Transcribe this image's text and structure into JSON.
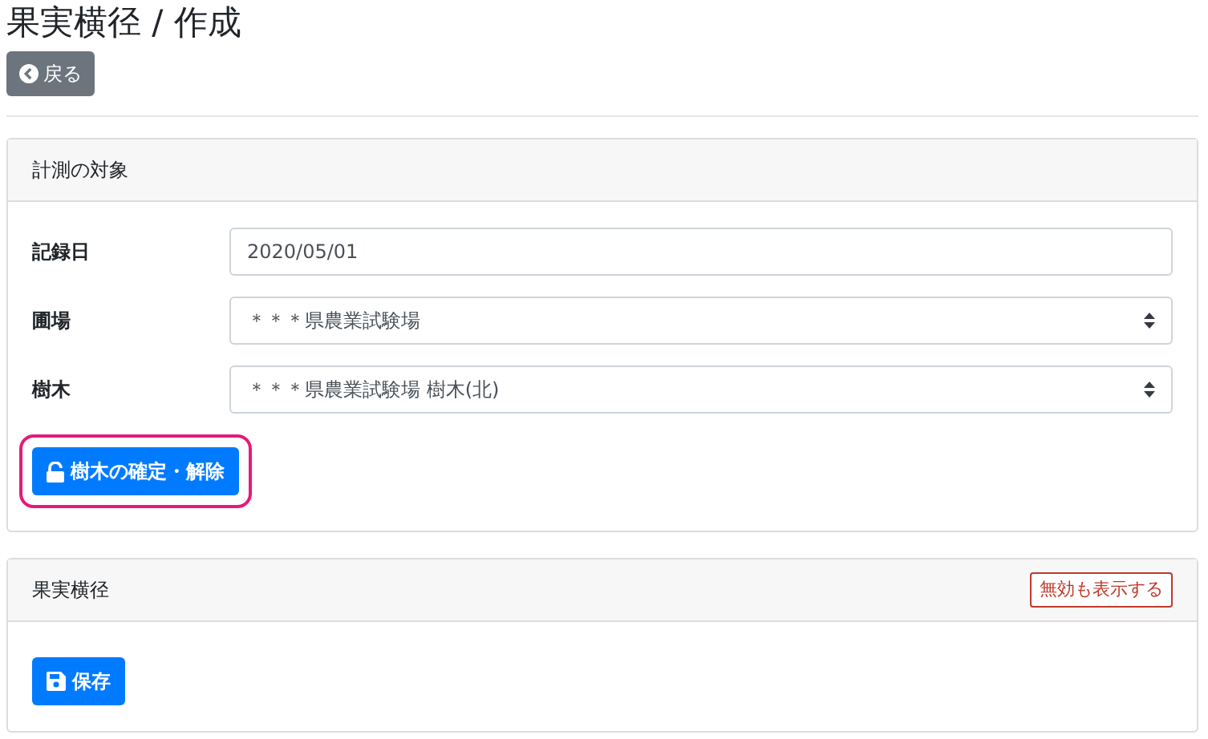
{
  "title": "果実横径 / 作成",
  "back_button": "戻る",
  "target_card": {
    "header": "計測の対象",
    "fields": [
      {
        "kind": "input",
        "label": "記録日",
        "value": "2020/05/01"
      },
      {
        "kind": "select",
        "label": "圃場",
        "value": "＊＊＊県農業試験場"
      },
      {
        "kind": "select",
        "label": "樹木",
        "value": "＊＊＊県農業試験場 樹木(北)"
      }
    ],
    "lock_button": {
      "label": "樹木の確定・解除",
      "highlighted": true
    }
  },
  "diameter_card": {
    "header": "果実横径",
    "toggle_button": "無効も表示する",
    "save_button": "保存"
  }
}
